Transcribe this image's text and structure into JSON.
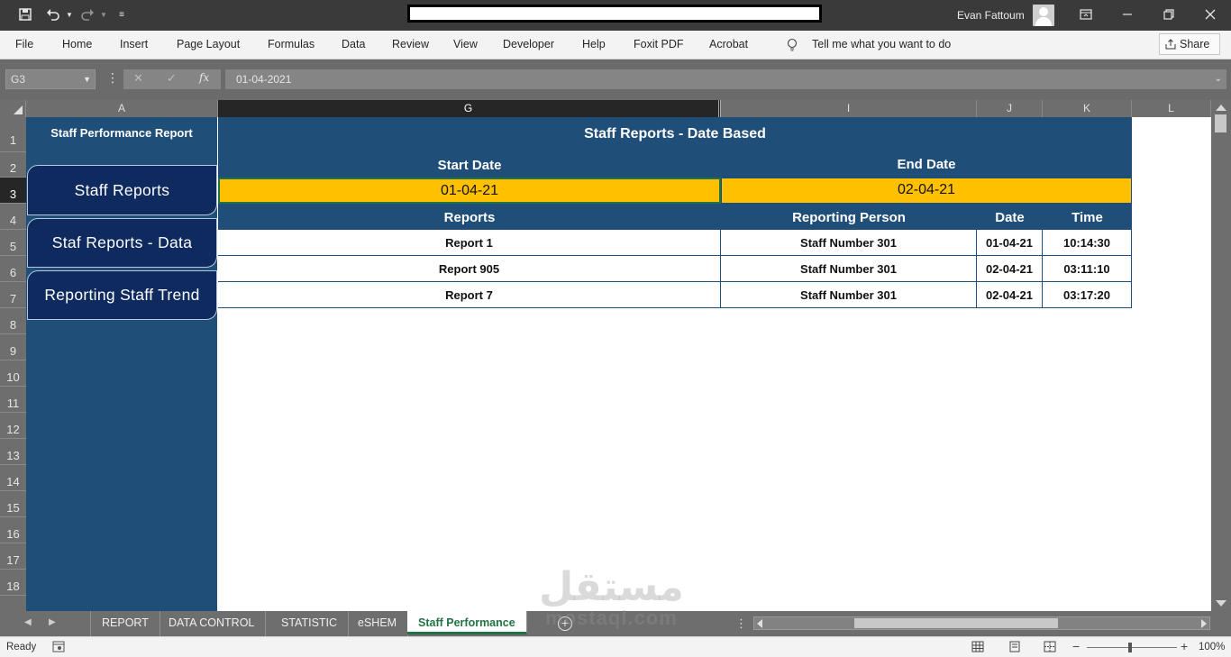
{
  "window": {
    "user_name": "Evan Fattoum",
    "icons": [
      "save-icon",
      "undo-icon",
      "redo-icon",
      "customize-icon",
      "ribbon-display-icon",
      "minimize-icon",
      "restore-icon",
      "close-icon"
    ]
  },
  "ribbon": {
    "tabs": [
      "File",
      "Home",
      "Insert",
      "Page Layout",
      "Formulas",
      "Data",
      "Review",
      "View",
      "Developer",
      "Help",
      "Foxit PDF",
      "Acrobat"
    ],
    "tell_me": "Tell me what you want to do",
    "share": "Share"
  },
  "formula_bar": {
    "name_box": "G3",
    "value": "01-04-2021",
    "fx": "fx"
  },
  "columns": [
    "A",
    "G",
    "I",
    "J",
    "K",
    "L"
  ],
  "rows": [
    "1",
    "2",
    "3",
    "4",
    "5",
    "6",
    "7",
    "8",
    "9",
    "10",
    "11",
    "12",
    "13",
    "14",
    "15",
    "16",
    "17",
    "18"
  ],
  "sidebar": {
    "title": "Staff Performance Report",
    "buttons": [
      "Staff Reports",
      "Staf Reports - Data",
      "Reporting Staff Trend"
    ]
  },
  "report": {
    "title": "Staff Reports - Date Based",
    "start_label": "Start Date",
    "end_label": "End Date",
    "start_value": "01-04-21",
    "end_value": "02-04-21",
    "table": {
      "headers": [
        "Reports",
        "Reporting Person",
        "Date",
        "Time"
      ],
      "rows": [
        [
          "Report 1",
          "Staff Number 301",
          "01-04-21",
          "10:14:30"
        ],
        [
          "Report 905",
          "Staff Number 301",
          "02-04-21",
          "03:11:10"
        ],
        [
          "Report 7",
          "Staff Number 301",
          "02-04-21",
          "03:17:20"
        ]
      ]
    }
  },
  "sheet_tabs": {
    "tabs": [
      "REPORT",
      "DATA CONTROL",
      "STATISTIC",
      "eSHEM",
      "Staff Performance"
    ],
    "active": "Staff Performance"
  },
  "status": {
    "ready": "Ready",
    "zoom": "100%"
  },
  "watermark": {
    "arabic": "مستقل",
    "latin": "mostaql.com"
  },
  "colors": {
    "navy": "#1f4e79",
    "nav_button": "#0f2a5e",
    "date_fill": "#ffc000",
    "excel_green": "#217346"
  }
}
